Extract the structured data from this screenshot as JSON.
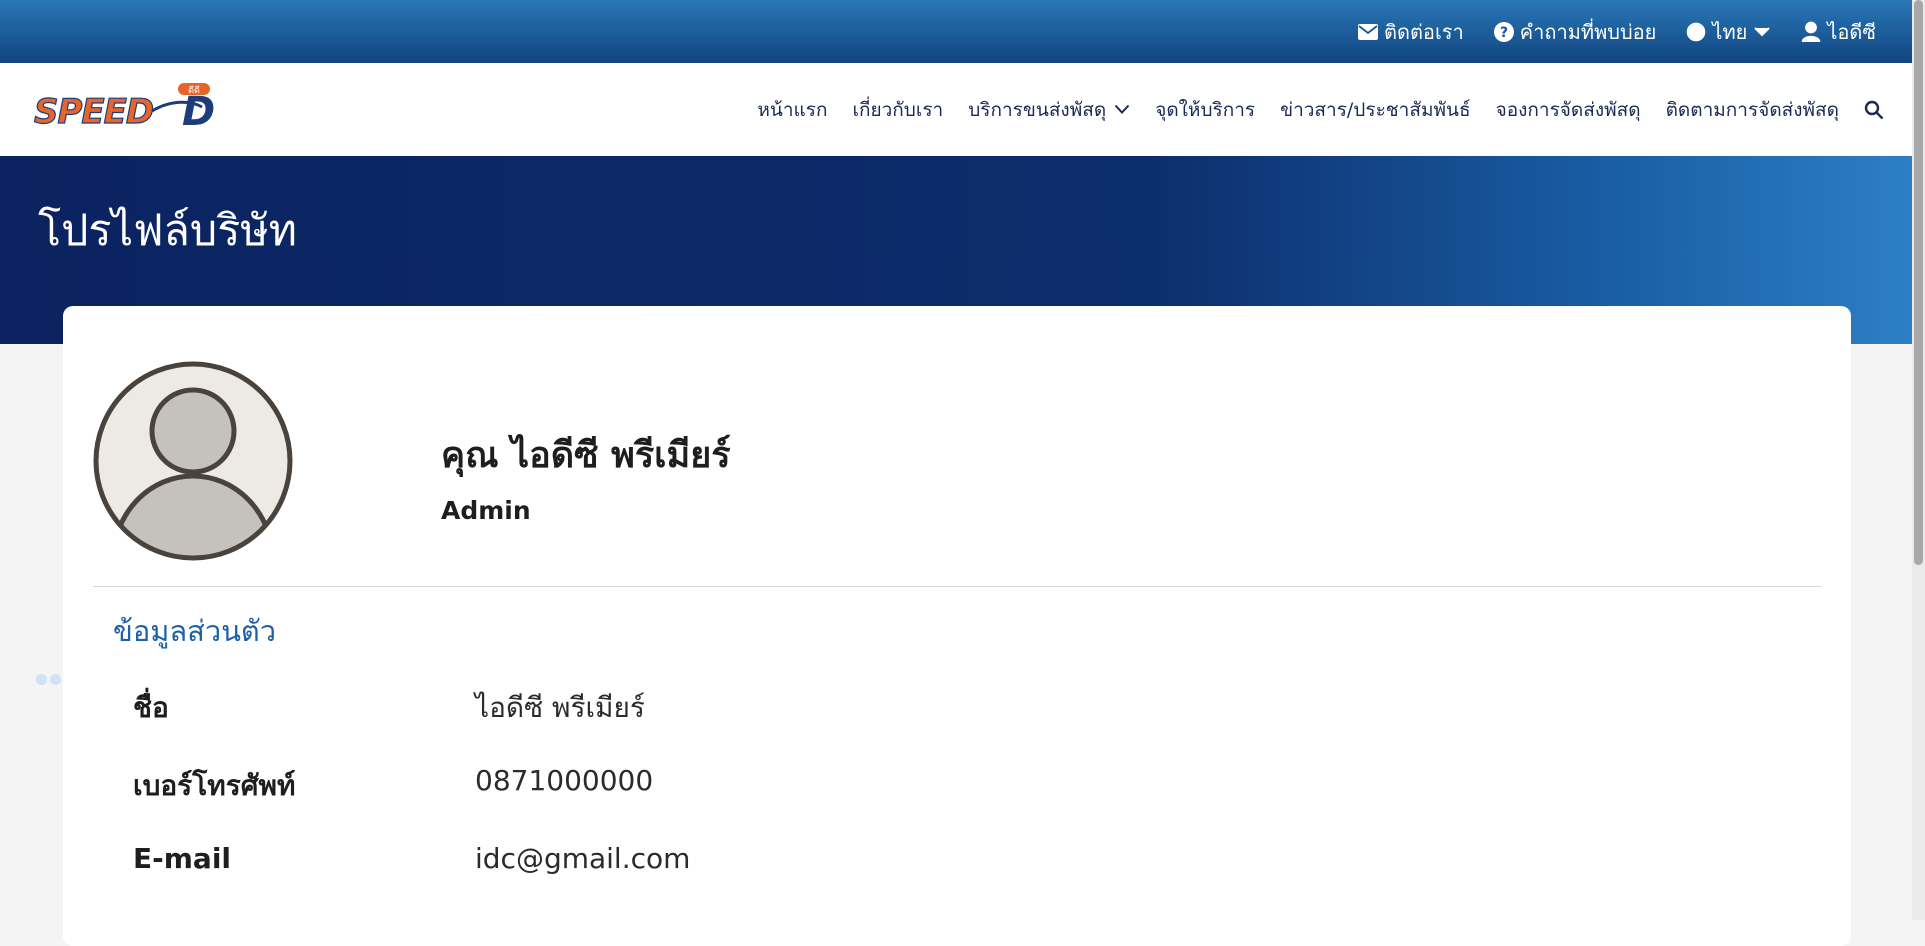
{
  "topbar": {
    "contact": "ติดต่อเรา",
    "faq": "คำถามที่พบบ่อย",
    "language": "ไทย",
    "user": "ไอดีซี"
  },
  "logo": {
    "text": "SPEED",
    "letter": "D",
    "badge": "ดีดี"
  },
  "nav": [
    {
      "label": "หน้าแรก"
    },
    {
      "label": "เกี่ยวกับเรา"
    },
    {
      "label": "บริการขนส่งพัสดุ"
    },
    {
      "label": "จุดให้บริการ"
    },
    {
      "label": "ข่าวสาร/ประชาสัมพันธ์"
    },
    {
      "label": "จองการจัดส่งพัสดุ"
    },
    {
      "label": "ติดตามการจัดส่งพัสดุ"
    }
  ],
  "page": {
    "title": "โปรไฟล์บริษัท"
  },
  "profile": {
    "name": "คุณ ไอดีซี พรีเมียร์",
    "role": "Admin",
    "section_title": "ข้อมูลส่วนตัว",
    "fields": [
      {
        "label": "ชื่อ",
        "value": "ไอดีซี พรีเมียร์"
      },
      {
        "label": "เบอร์โทรศัพท์",
        "value": "0871000000"
      },
      {
        "label": "E-mail",
        "value": "idc@gmail.com"
      }
    ]
  },
  "colors": {
    "primary": "#0c2d6c",
    "accent": "#1d5fa8",
    "brand_orange": "#e8652a"
  },
  "icons": [
    "envelope-icon",
    "question-circle-icon",
    "globe-icon",
    "chevron-down-icon",
    "user-icon",
    "search-icon"
  ]
}
